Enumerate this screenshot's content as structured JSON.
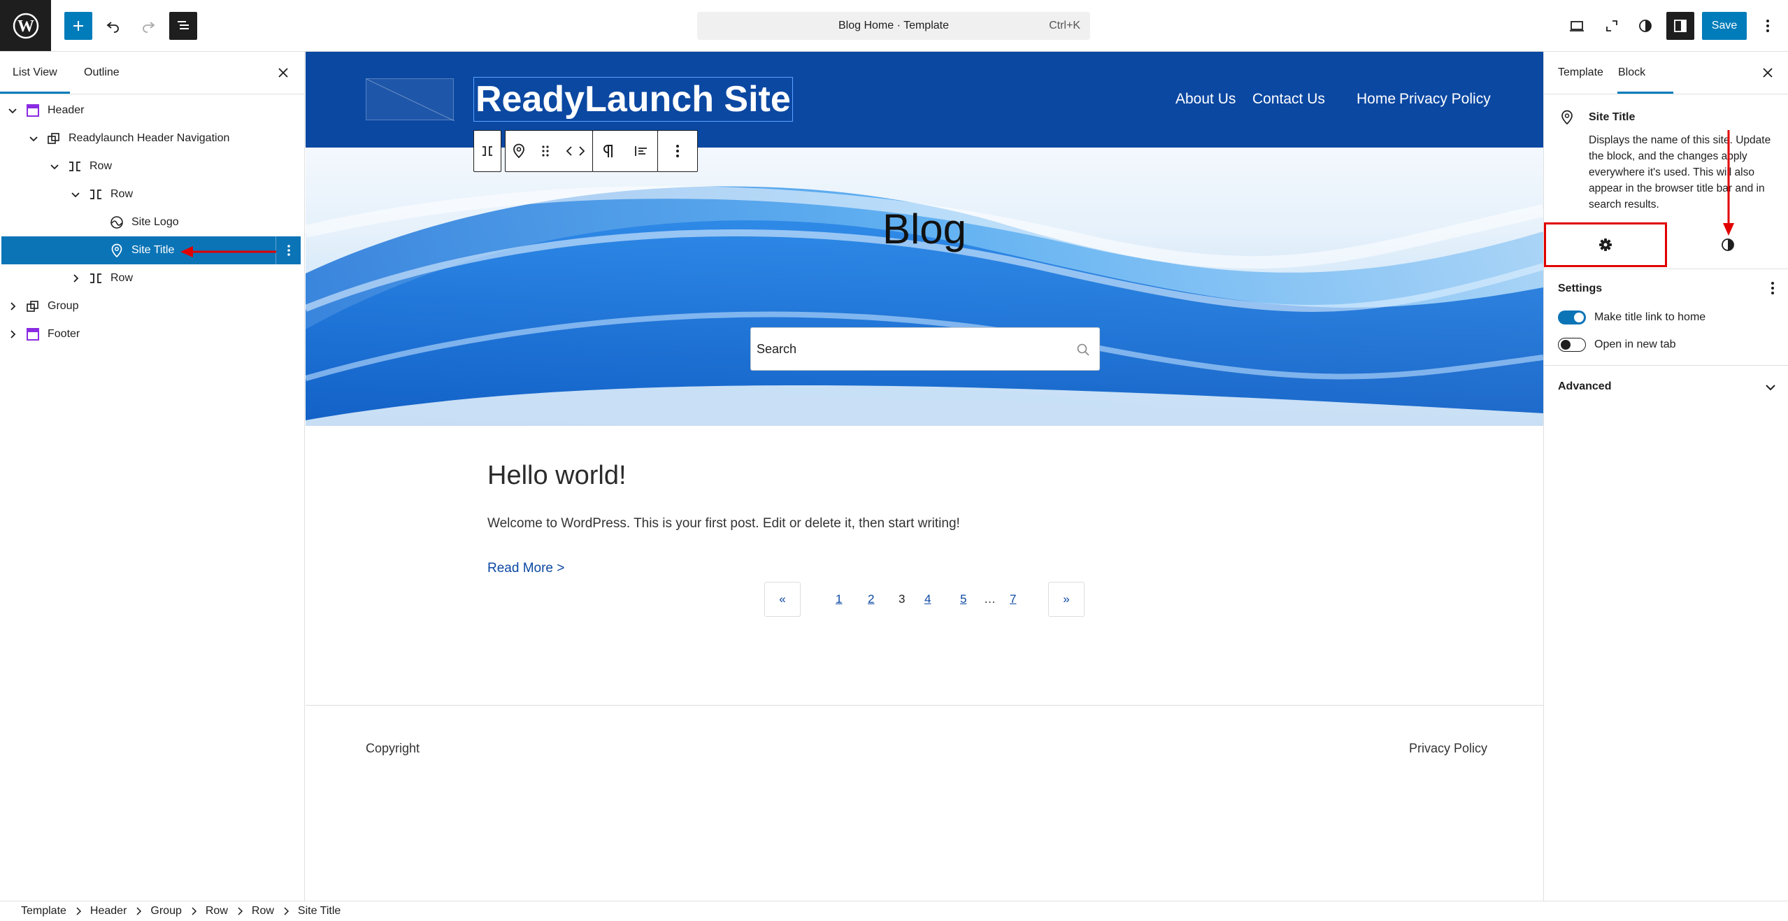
{
  "topbar": {
    "command_title": "Blog Home · Template",
    "command_shortcut": "Ctrl+K",
    "save_label": "Save"
  },
  "left_panel": {
    "tabs": [
      {
        "label": "List View"
      },
      {
        "label": "Outline"
      }
    ],
    "tree": [
      {
        "label": "Header",
        "icon": "template-part-icon",
        "level": 0,
        "expanded": true
      },
      {
        "label": "Readylaunch Header Navigation",
        "icon": "reusable-block-icon",
        "level": 1,
        "expanded": true
      },
      {
        "label": "Row",
        "icon": "row-icon",
        "level": 2,
        "expanded": true
      },
      {
        "label": "Row",
        "icon": "row-icon",
        "level": 3,
        "expanded": true
      },
      {
        "label": "Site Logo",
        "icon": "site-logo-icon",
        "level": 4,
        "expanded": null
      },
      {
        "label": "Site Title",
        "icon": "map-marker-icon",
        "level": 4,
        "expanded": null,
        "selected": true
      },
      {
        "label": "Row",
        "icon": "row-icon",
        "level": 3,
        "expanded": false
      },
      {
        "label": "Group",
        "icon": "group-icon",
        "level": 0,
        "expanded": false
      },
      {
        "label": "Footer",
        "icon": "template-part-icon",
        "level": 0,
        "expanded": false
      }
    ]
  },
  "canvas": {
    "site_title": "ReadyLaunch Site",
    "nav": [
      "About Us",
      "Contact Us",
      "Home",
      "Privacy Policy"
    ],
    "hero_title": "Blog",
    "search_text": "Search",
    "post": {
      "title": "Hello world!",
      "excerpt": "Welcome to WordPress. This is your first post. Edit or delete it, then start writing!",
      "read_more": "Read More >"
    },
    "pagination": {
      "prev": "«",
      "next": "»",
      "pages": [
        "1",
        "2",
        "3",
        "4",
        "5",
        "…",
        "7"
      ],
      "current": "3"
    },
    "footer": {
      "copyright": "Copyright",
      "privacy": "Privacy Policy"
    }
  },
  "right_panel": {
    "tabs": [
      {
        "label": "Template"
      },
      {
        "label": "Block"
      }
    ],
    "block": {
      "name": "Site Title",
      "description": "Displays the name of this site. Update the block, and the changes apply everywhere it's used. This will also appear in the browser title bar and in search results."
    },
    "settings_heading": "Settings",
    "toggles": [
      {
        "label": "Make title link to home",
        "on": true
      },
      {
        "label": "Open in new tab",
        "on": false
      }
    ],
    "advanced_heading": "Advanced"
  },
  "breadcrumb": [
    "Template",
    "Header",
    "Group",
    "Row",
    "Row",
    "Site Title"
  ],
  "colors": {
    "accent": "#007cba",
    "header_bg": "#0b48a2",
    "selected_row": "#0b74b7",
    "annotation": "#e00000"
  }
}
